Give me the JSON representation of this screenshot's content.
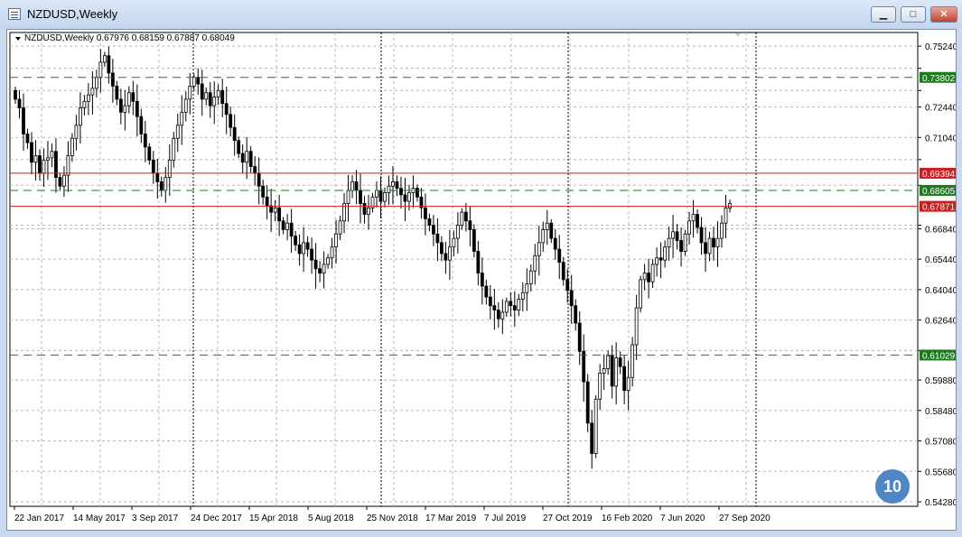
{
  "window": {
    "title": "NZDUSD,Weekly",
    "minimize_label": "▁",
    "maximize_label": "□",
    "close_label": "✕"
  },
  "chart_data": {
    "type": "candlestick",
    "symbol_info": "NZDUSD,Weekly",
    "ohlc_info": "0.67976 0.68159 0.67887 0.68049",
    "ylim": [
      0.5428,
      0.7566
    ],
    "grid": true,
    "price_ticks": [
      "0.75240",
      "0.74220",
      "0.73200",
      "0.72440",
      "0.71040",
      "0.70020",
      "0.68840",
      "0.67000",
      "0.66840",
      "0.65440",
      "0.64040",
      "0.62640",
      "0.61240",
      "0.59880",
      "0.58480",
      "0.57080",
      "0.55680",
      "0.54280"
    ],
    "visible_tick_labels": [
      "0.75240",
      "0.72440",
      "0.71040",
      "0.66840",
      "0.65440",
      "0.64040",
      "0.62640",
      "0.59880",
      "0.58480",
      "0.57080",
      "0.55680",
      "0.54280"
    ],
    "x_labels": [
      "22 Jan 2017",
      "14 May 2017",
      "3 Sep 2017",
      "24 Dec 2017",
      "15 Apr 2018",
      "5 Aug 2018",
      "25 Nov 2018",
      "17 Mar 2019",
      "7 Jul 2019",
      "27 Oct 2019",
      "16 Feb 2020",
      "7 Jun 2020",
      "27 Sep 2020"
    ],
    "levels": [
      {
        "label": "0.73802",
        "style": "dashed",
        "color": "#1e7a1e"
      },
      {
        "label": "0.69394",
        "style": "solid",
        "color": "#cc1e1e"
      },
      {
        "label": "0.68605",
        "style": "dashed",
        "color": "#1e7a1e"
      },
      {
        "label": "0.67871",
        "style": "solid",
        "color": "#cc1e1e"
      },
      {
        "label": "0.61029",
        "style": "dashed",
        "color": "#1e7a1e"
      }
    ],
    "level_values": [
      0.73802,
      0.69394,
      0.68605,
      0.67871,
      0.61029
    ],
    "close_path": [
      0.728,
      0.724,
      0.712,
      0.708,
      0.699,
      0.702,
      0.694,
      0.7,
      0.701,
      0.704,
      0.692,
      0.688,
      0.693,
      0.702,
      0.71,
      0.716,
      0.724,
      0.727,
      0.73,
      0.733,
      0.738,
      0.745,
      0.748,
      0.74,
      0.734,
      0.728,
      0.722,
      0.725,
      0.731,
      0.727,
      0.72,
      0.712,
      0.706,
      0.7,
      0.694,
      0.69,
      0.686,
      0.692,
      0.7,
      0.71,
      0.716,
      0.722,
      0.728,
      0.734,
      0.738,
      0.735,
      0.728,
      0.731,
      0.725,
      0.729,
      0.732,
      0.726,
      0.721,
      0.715,
      0.709,
      0.703,
      0.699,
      0.704,
      0.697,
      0.694,
      0.688,
      0.683,
      0.679,
      0.676,
      0.678,
      0.672,
      0.668,
      0.671,
      0.665,
      0.661,
      0.657,
      0.662,
      0.659,
      0.654,
      0.65,
      0.648,
      0.652,
      0.655,
      0.66,
      0.666,
      0.672,
      0.68,
      0.686,
      0.69,
      0.686,
      0.68,
      0.675,
      0.678,
      0.683,
      0.686,
      0.681,
      0.685,
      0.688,
      0.69,
      0.687,
      0.684,
      0.681,
      0.685,
      0.687,
      0.683,
      0.678,
      0.673,
      0.67,
      0.666,
      0.662,
      0.657,
      0.654,
      0.66,
      0.664,
      0.67,
      0.676,
      0.672,
      0.668,
      0.658,
      0.648,
      0.642,
      0.637,
      0.633,
      0.631,
      0.627,
      0.63,
      0.635,
      0.633,
      0.631,
      0.636,
      0.639,
      0.643,
      0.649,
      0.656,
      0.662,
      0.668,
      0.671,
      0.664,
      0.659,
      0.653,
      0.645,
      0.64,
      0.633,
      0.625,
      0.612,
      0.598,
      0.579,
      0.565,
      0.59,
      0.602,
      0.604,
      0.61,
      0.596,
      0.609,
      0.605,
      0.594,
      0.6,
      0.615,
      0.632,
      0.645,
      0.648,
      0.644,
      0.652,
      0.655,
      0.654,
      0.66,
      0.664,
      0.667,
      0.663,
      0.658,
      0.666,
      0.672,
      0.675,
      0.669,
      0.662,
      0.657,
      0.664,
      0.66,
      0.664,
      0.671,
      0.678,
      0.68
    ],
    "candle_count": 189,
    "last_close": 0.68049,
    "vertical_separators": [
      "24 Dec 2017",
      "25 Nov 2018",
      "27 Oct 2019",
      "27 Sep 2020"
    ]
  },
  "badge": {
    "label": "10"
  }
}
